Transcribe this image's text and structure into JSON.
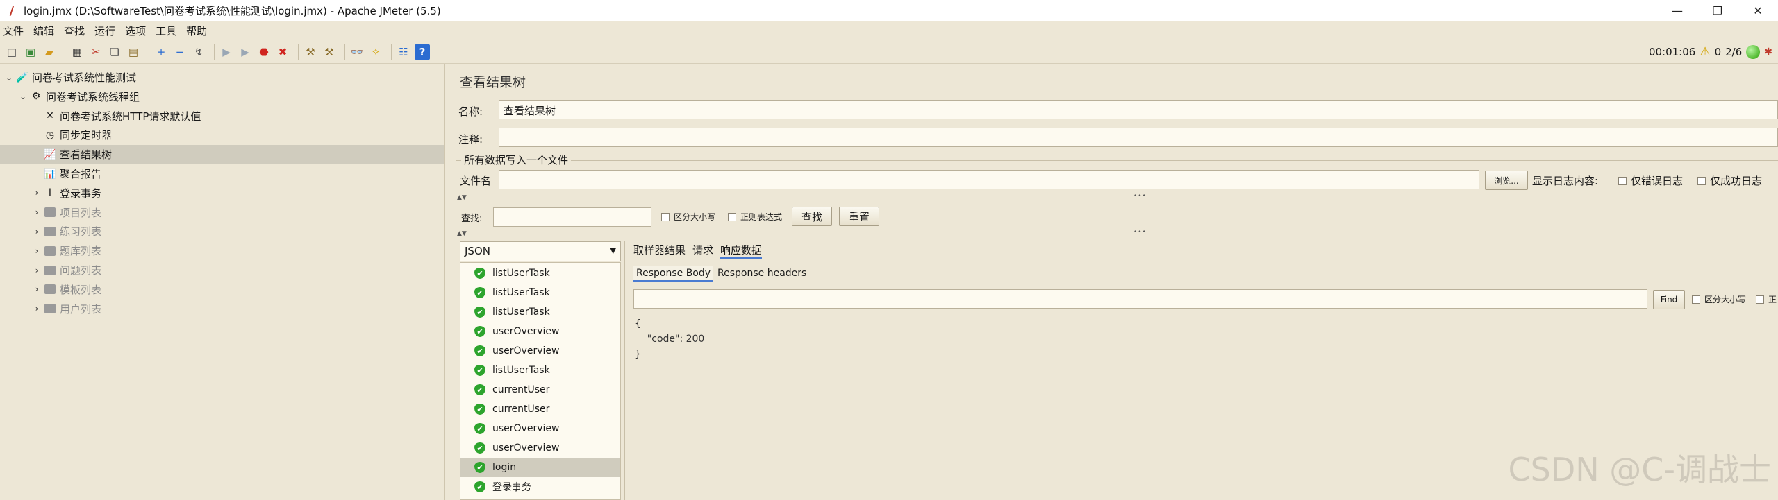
{
  "window": {
    "title": "login.jmx (D:\\SoftwareTest\\问卷考试系统\\性能测试\\login.jmx) - Apache JMeter (5.5)",
    "controls": [
      "—",
      "❐",
      "✕"
    ]
  },
  "menu": [
    "文件",
    "编辑",
    "查找",
    "运行",
    "选项",
    "工具",
    "帮助"
  ],
  "toolbar": {
    "buttons": [
      {
        "name": "new-icon",
        "glyph": "□",
        "color": "#555"
      },
      {
        "name": "templates-icon",
        "glyph": "▣",
        "color": "#3a8a3a"
      },
      {
        "name": "open-icon",
        "glyph": "▰",
        "color": "#d49a1e"
      },
      {
        "name": "save-icon",
        "glyph": "▦",
        "color": "#333"
      },
      {
        "name": "cut-icon",
        "glyph": "✂",
        "color": "#c0392b"
      },
      {
        "name": "copy-icon",
        "glyph": "❏",
        "color": "#555"
      },
      {
        "name": "paste-icon",
        "glyph": "▤",
        "color": "#8a6d2b"
      },
      {
        "name": "expand-icon",
        "glyph": "+",
        "color": "#2b6cd1"
      },
      {
        "name": "collapse-icon",
        "glyph": "−",
        "color": "#2b6cd1"
      },
      {
        "name": "toggle-icon",
        "glyph": "↯",
        "color": "#555"
      },
      {
        "name": "start-icon",
        "glyph": "▶",
        "color": "#9aa7b5"
      },
      {
        "name": "start-no-pause-icon",
        "glyph": "▶",
        "color": "#9aa7b5"
      },
      {
        "name": "stop-icon",
        "glyph": "⬣",
        "color": "#d0251f"
      },
      {
        "name": "shutdown-icon",
        "glyph": "✖",
        "color": "#d0251f"
      },
      {
        "name": "clear-icon",
        "glyph": "⚒",
        "color": "#8a6d2b"
      },
      {
        "name": "clear-all-icon",
        "glyph": "⚒",
        "color": "#8a6d2b"
      },
      {
        "name": "search-icon",
        "glyph": "👓",
        "color": "#333"
      },
      {
        "name": "reset-search-icon",
        "glyph": "✧",
        "color": "#d4a400"
      },
      {
        "name": "function-helper-icon",
        "glyph": "☷",
        "color": "#2b6cd1"
      },
      {
        "name": "help-icon",
        "glyph": "?",
        "color": "#ffffff"
      }
    ],
    "timer": "00:01:06",
    "warnings": "0",
    "threads": "2/6"
  },
  "tree": [
    {
      "label": "问卷考试系统性能测试",
      "toggle": "⌄",
      "icon": "🧪",
      "depth": 0,
      "disabled": false,
      "selected": false
    },
    {
      "label": "问卷考试系统线程组",
      "toggle": "⌄",
      "icon": "⚙",
      "depth": 1,
      "disabled": false,
      "selected": false
    },
    {
      "label": "问卷考试系统HTTP请求默认值",
      "toggle": "",
      "icon": "✕",
      "depth": 2,
      "disabled": false,
      "selected": false
    },
    {
      "label": "同步定时器",
      "toggle": "",
      "icon": "◷",
      "depth": 2,
      "disabled": false,
      "selected": false
    },
    {
      "label": "查看结果树",
      "toggle": "",
      "icon": "📈",
      "depth": 2,
      "disabled": false,
      "selected": true
    },
    {
      "label": "聚合报告",
      "toggle": "",
      "icon": "📊",
      "depth": 2,
      "disabled": false,
      "selected": false
    },
    {
      "label": "登录事务",
      "toggle": "›",
      "icon": "Ⅰ",
      "depth": 2,
      "disabled": false,
      "selected": false
    },
    {
      "label": "项目列表",
      "toggle": "›",
      "icon": "box",
      "depth": 2,
      "disabled": true,
      "selected": false
    },
    {
      "label": "练习列表",
      "toggle": "›",
      "icon": "box",
      "depth": 2,
      "disabled": true,
      "selected": false
    },
    {
      "label": "题库列表",
      "toggle": "›",
      "icon": "box",
      "depth": 2,
      "disabled": true,
      "selected": false
    },
    {
      "label": "问题列表",
      "toggle": "›",
      "icon": "box",
      "depth": 2,
      "disabled": true,
      "selected": false
    },
    {
      "label": "模板列表",
      "toggle": "›",
      "icon": "box",
      "depth": 2,
      "disabled": true,
      "selected": false
    },
    {
      "label": "用户列表",
      "toggle": "›",
      "icon": "box",
      "depth": 2,
      "disabled": true,
      "selected": false
    }
  ],
  "panel": {
    "title": "查看结果树",
    "name_label": "名称:",
    "name_value": "查看结果树",
    "comment_label": "注释:",
    "comment_value": "",
    "file_group_title": "所有数据写入一个文件",
    "filename_label": "文件名",
    "browse_label": "浏览...",
    "log_display_label": "显示日志内容:",
    "errors_only_label": "仅错误日志",
    "success_only_label": "仅成功日志",
    "search_label": "查找:",
    "case_sensitive_label": "区分大小写",
    "regex_label": "正则表达式",
    "search_button": "查找",
    "reset_button": "重置",
    "renderer": "JSON"
  },
  "samples": [
    {
      "label": "listUserTask",
      "selected": false
    },
    {
      "label": "listUserTask",
      "selected": false
    },
    {
      "label": "listUserTask",
      "selected": false
    },
    {
      "label": "userOverview",
      "selected": false
    },
    {
      "label": "userOverview",
      "selected": false
    },
    {
      "label": "listUserTask",
      "selected": false
    },
    {
      "label": "currentUser",
      "selected": false
    },
    {
      "label": "currentUser",
      "selected": false
    },
    {
      "label": "userOverview",
      "selected": false
    },
    {
      "label": "userOverview",
      "selected": false
    },
    {
      "label": "login",
      "selected": true
    },
    {
      "label": "登录事务",
      "selected": false
    }
  ],
  "result_tabs": [
    "取样器结果",
    "请求",
    "响应数据"
  ],
  "result_tab_active": 2,
  "sub_tabs": [
    "Response Body",
    "Response headers"
  ],
  "sub_tab_active": 0,
  "find_button": "Find",
  "find_case_label": "区分大小写",
  "find_regex_label": "正",
  "response_body": "{\n    \"code\": 200\n}",
  "watermark": "CSDN @C-调战士"
}
